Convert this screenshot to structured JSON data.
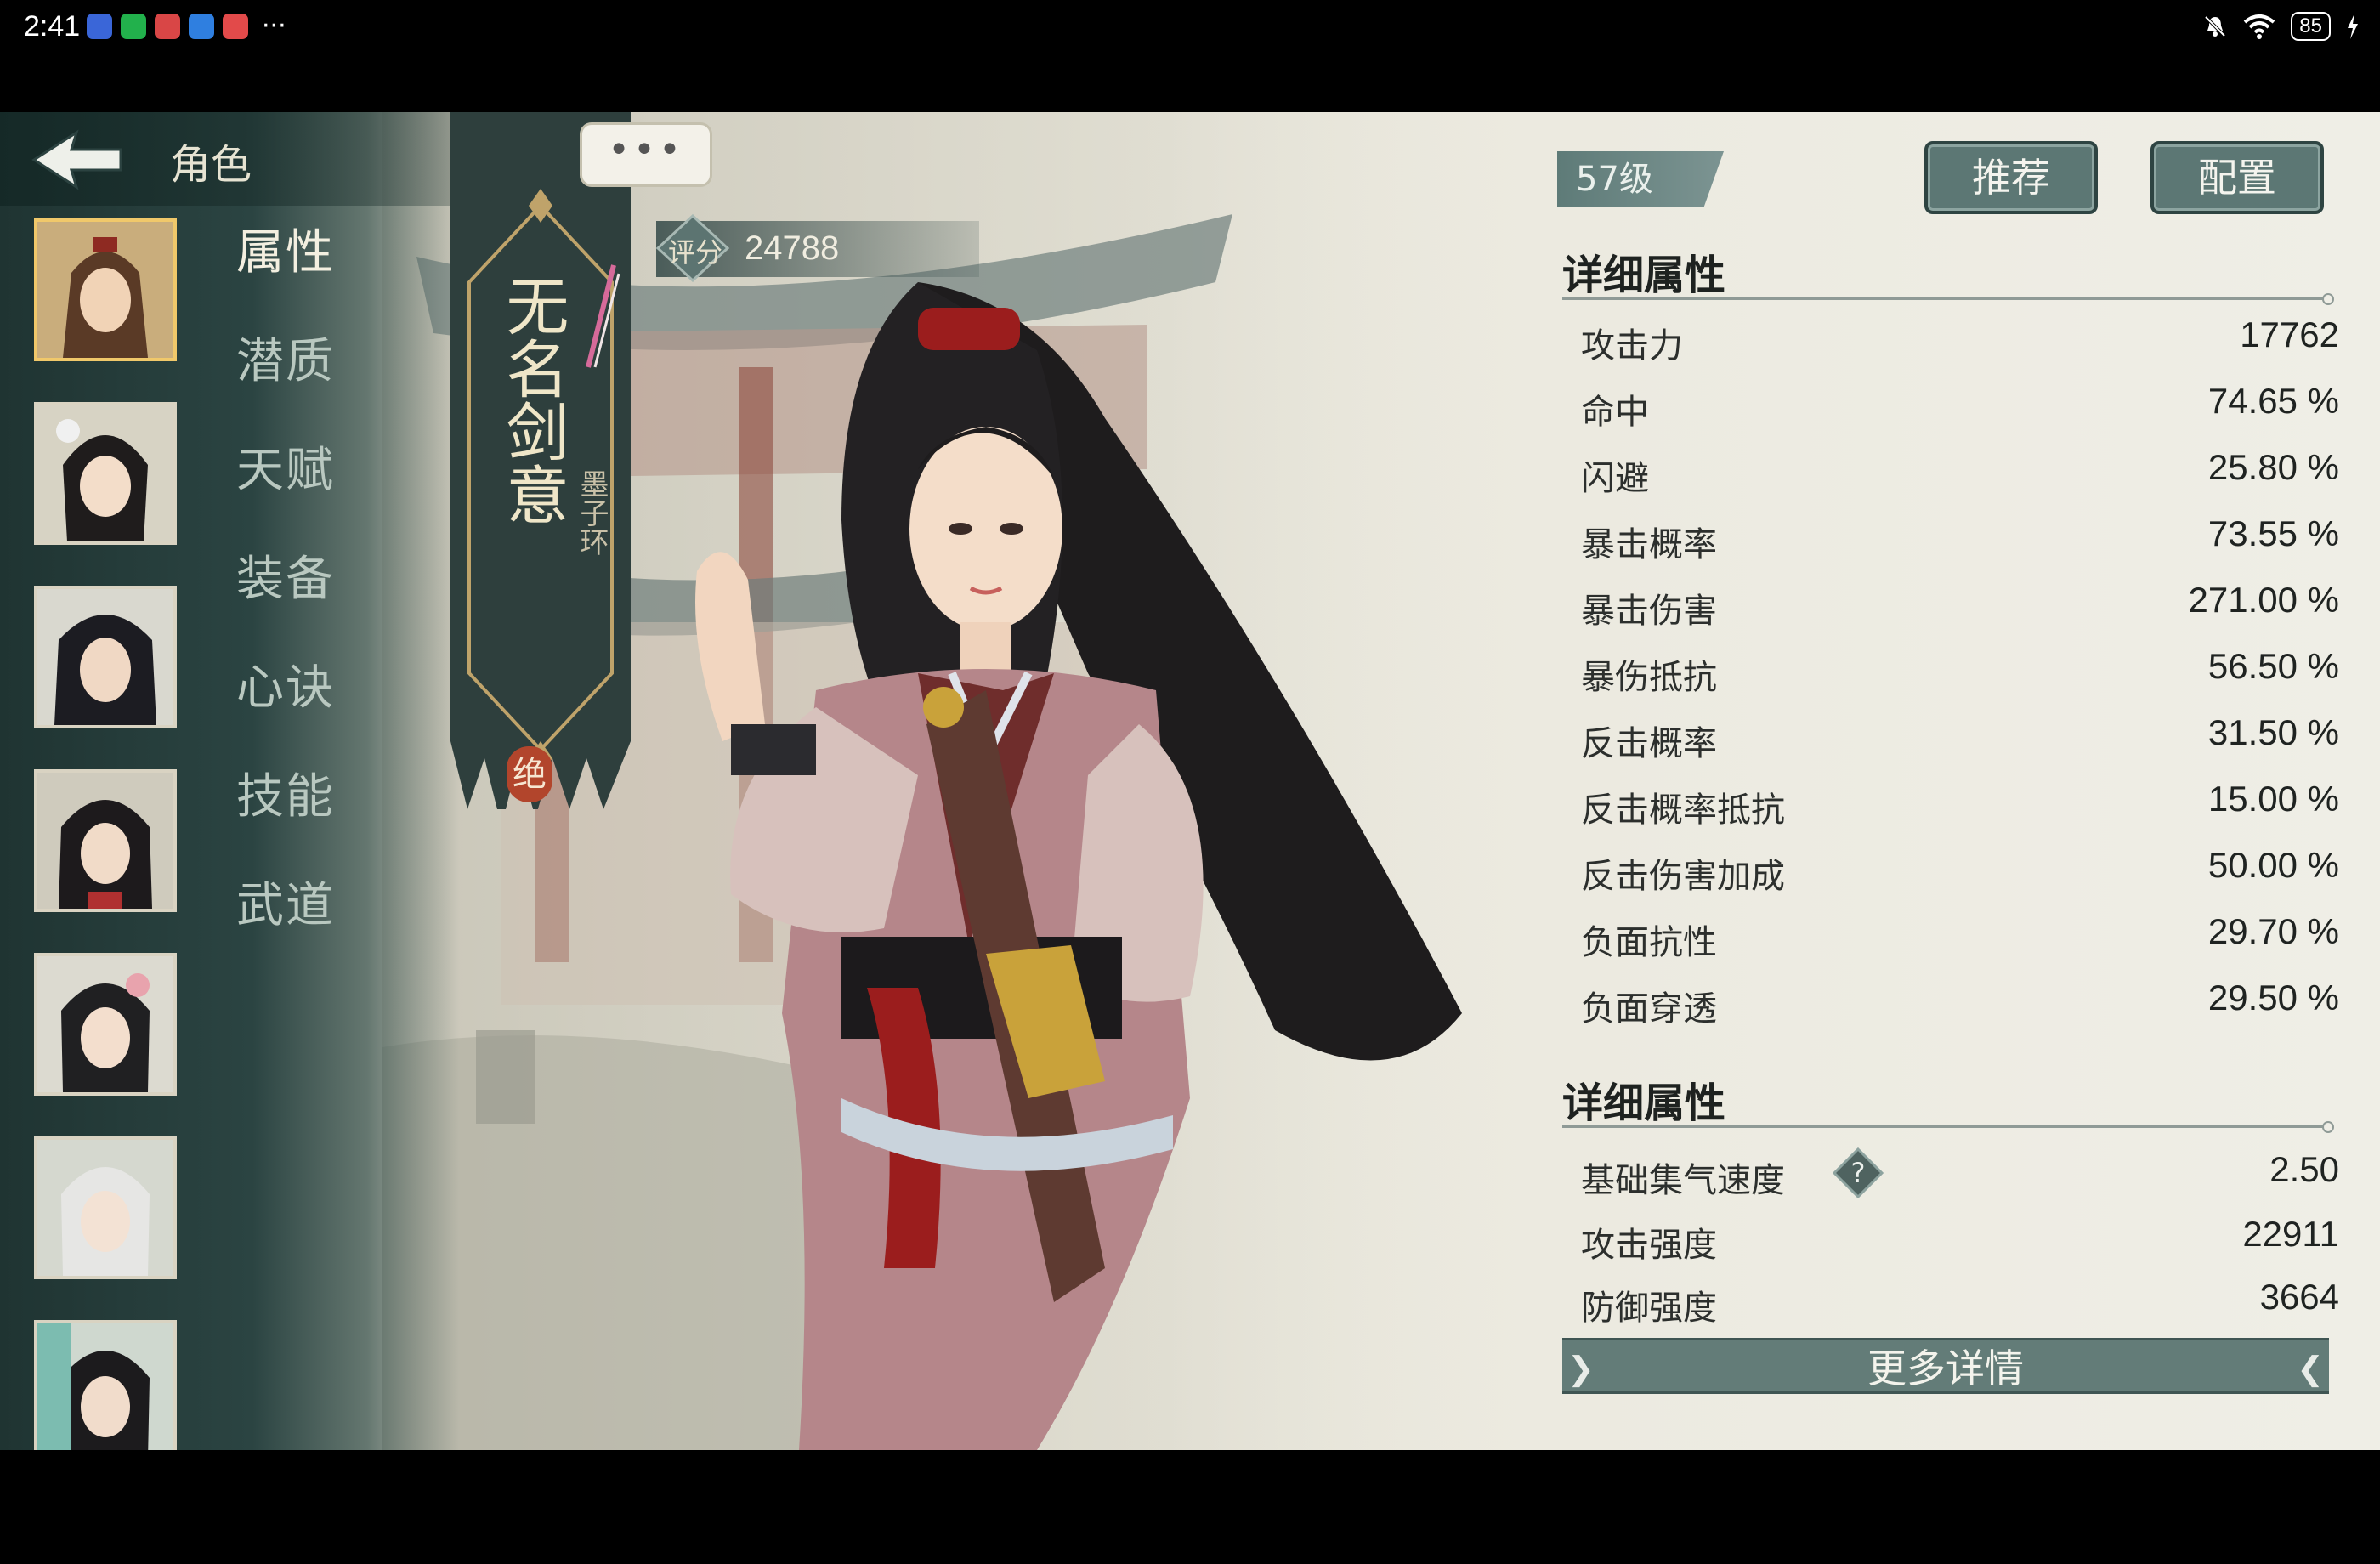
{
  "status_bar": {
    "time": "2:41",
    "more": "···",
    "battery": "85",
    "app_colors": [
      "#3a66d8",
      "#22b14c",
      "#d94646",
      "#2f7fe0",
      "#e24a4a"
    ]
  },
  "header": {
    "title": "角色"
  },
  "menu": {
    "items": [
      "属性",
      "潜质",
      "天赋",
      "装备",
      "心诀",
      "技能",
      "武道"
    ]
  },
  "character": {
    "name": "无名剑意",
    "subtitle": "墨子环",
    "rarity": "绝",
    "bubble": "•••",
    "score_label": "评分",
    "score": "24788",
    "level": "57级"
  },
  "buttons": {
    "recommend": "推荐",
    "config": "配置",
    "more_details": "更多详情"
  },
  "sections": {
    "detail_title_1": "详细属性",
    "detail_title_2": "详细属性"
  },
  "stats": [
    {
      "label": "攻击力",
      "value": "17762"
    },
    {
      "label": "命中",
      "value": "74.65 %"
    },
    {
      "label": "闪避",
      "value": "25.80 %"
    },
    {
      "label": "暴击概率",
      "value": "73.55 %"
    },
    {
      "label": "暴击伤害",
      "value": "271.00 %"
    },
    {
      "label": "暴伤抵抗",
      "value": "56.50 %"
    },
    {
      "label": "反击概率",
      "value": "31.50 %"
    },
    {
      "label": "反击概率抵抗",
      "value": "15.00 %"
    },
    {
      "label": "反击伤害加成",
      "value": "50.00 %"
    },
    {
      "label": "负面抗性",
      "value": "29.70 %"
    },
    {
      "label": "负面穿透",
      "value": "29.50 %"
    }
  ],
  "stats2": [
    {
      "label": "基础集气速度",
      "value": "2.50"
    },
    {
      "label": "攻击强度",
      "value": "22911"
    },
    {
      "label": "防御强度",
      "value": "3664"
    }
  ]
}
